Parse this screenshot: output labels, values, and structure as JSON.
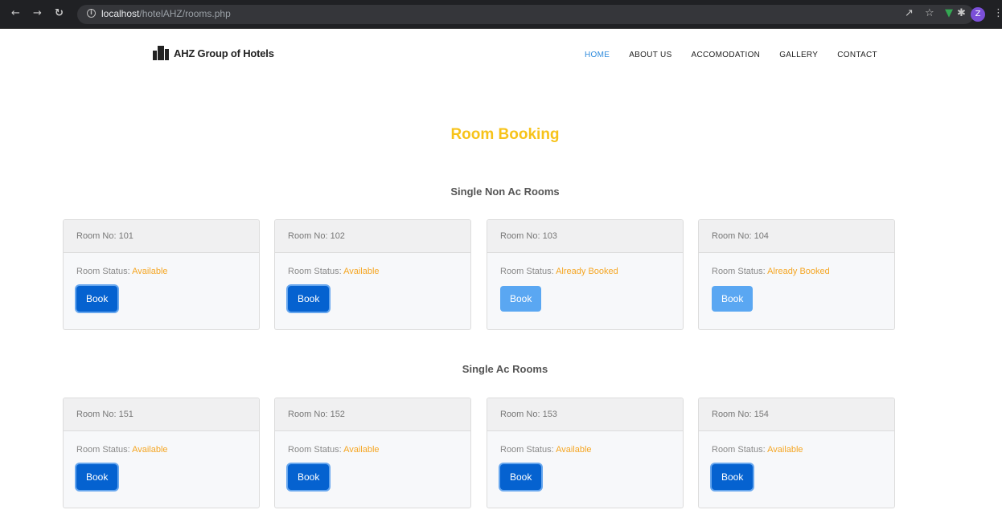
{
  "browser": {
    "url_host": "localhost",
    "url_path": "/hotelAHZ/rooms.php",
    "avatar_letter": "Z"
  },
  "header": {
    "brand": "AHZ Group of Hotels",
    "menu": [
      "HOME",
      "ABOUT US",
      "ACCOMODATION",
      "GALLERY",
      "CONTACT"
    ]
  },
  "page": {
    "title": "Room Booking",
    "status_label": "Room Status:",
    "book_label": "Book"
  },
  "sections": [
    {
      "title": "Single Non Ac Rooms",
      "rooms": [
        {
          "label": "Room No: 101",
          "status": "Available",
          "disabled": false
        },
        {
          "label": "Room No: 102",
          "status": "Available",
          "disabled": false
        },
        {
          "label": "Room No: 103",
          "status": "Already Booked",
          "disabled": true
        },
        {
          "label": "Room No: 104",
          "status": "Already Booked",
          "disabled": true
        }
      ]
    },
    {
      "title": "Single Ac Rooms",
      "rooms": [
        {
          "label": "Room No: 151",
          "status": "Available",
          "disabled": false
        },
        {
          "label": "Room No: 152",
          "status": "Available",
          "disabled": false
        },
        {
          "label": "Room No: 153",
          "status": "Available",
          "disabled": false
        },
        {
          "label": "Room No: 154",
          "status": "Available",
          "disabled": false
        }
      ]
    }
  ],
  "colors": {
    "accent_title": "#f7c31a",
    "status_value": "#f5a623",
    "button": "#0562d0",
    "button_disabled": "#5aa7f2",
    "nav_active": "#2e8bdc"
  }
}
